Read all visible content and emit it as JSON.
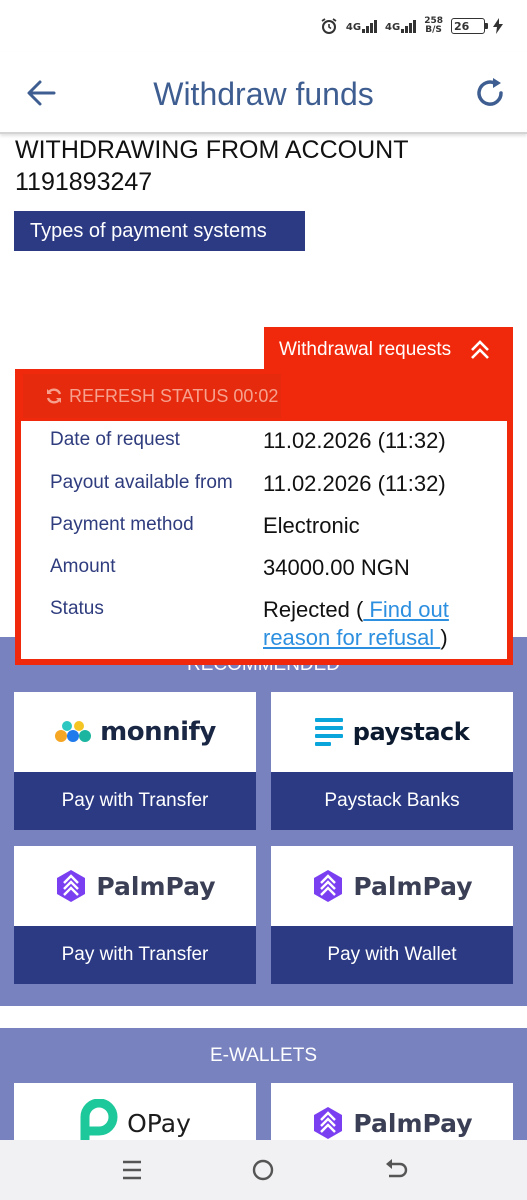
{
  "status_bar": {
    "network1": "4G",
    "network2": "4G",
    "speed_value": "258",
    "speed_unit": "B/S",
    "battery": "26"
  },
  "header": {
    "title": "Withdraw funds"
  },
  "account": {
    "heading": "WITHDRAWING FROM ACCOUNT 1191893247",
    "types_button": "Types of payment systems"
  },
  "withdrawal_requests": {
    "tab_label": "Withdrawal requests",
    "refresh_label": "REFRESH STATUS 00:02",
    "rows": [
      {
        "label": "Date of request",
        "value": "11.02.2026 (11:32)"
      },
      {
        "label": "Payout available from",
        "value": "11.02.2026 (11:32)"
      },
      {
        "label": "Payment method",
        "value": "Electronic"
      },
      {
        "label": "Amount",
        "value": "34000.00 NGN"
      },
      {
        "label": "Status",
        "value": "Rejected ("
      }
    ],
    "status_link": " Find out reason for refusal ",
    "status_close": ")"
  },
  "recommended": {
    "label": "RECOMMENDED",
    "cards": [
      {
        "brand": "monnify",
        "cta": "Pay with Transfer"
      },
      {
        "brand": "paystack",
        "cta": "Paystack Banks"
      },
      {
        "brand": "PalmPay",
        "cta": "Pay with Transfer"
      },
      {
        "brand": "PalmPay",
        "cta": "Pay with Wallet"
      }
    ]
  },
  "ewallets": {
    "label": "E-WALLETS",
    "cards": [
      {
        "brand": "OPay"
      },
      {
        "brand": "PalmPay"
      }
    ]
  },
  "colors": {
    "primary_navy": "#2b3a83",
    "section_purple": "#7882bf",
    "alert_red": "#f1290c",
    "title_blue": "#3e5d90",
    "link_blue": "#2d8fe0"
  }
}
